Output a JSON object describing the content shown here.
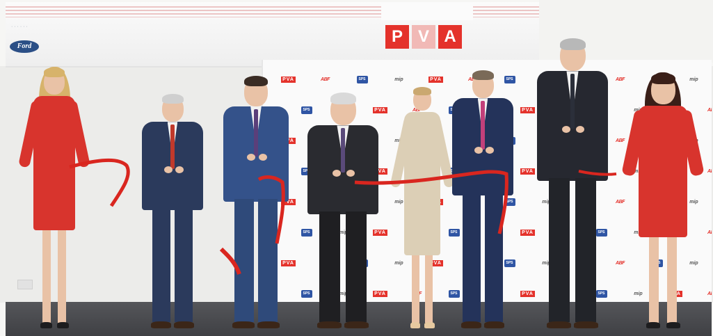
{
  "screen": {
    "brand_text": "Ford",
    "logo_letters": [
      "P",
      "V",
      "A"
    ]
  },
  "pressboard": {
    "logos": [
      "PVA",
      "ABF",
      "SPS",
      "mip"
    ]
  },
  "colors": {
    "ribbon": "#d9261f",
    "dress": "#d8342d",
    "suit_navy": "#2b3a5c",
    "suit_dark": "#2a2b30",
    "beige_dress": "#dccfb6",
    "brand_red": "#e4322b"
  },
  "people": [
    {
      "role": "hostess"
    },
    {
      "role": "guest"
    },
    {
      "role": "guest"
    },
    {
      "role": "guest"
    },
    {
      "role": "guest"
    },
    {
      "role": "guest"
    },
    {
      "role": "guest"
    },
    {
      "role": "hostess"
    }
  ]
}
